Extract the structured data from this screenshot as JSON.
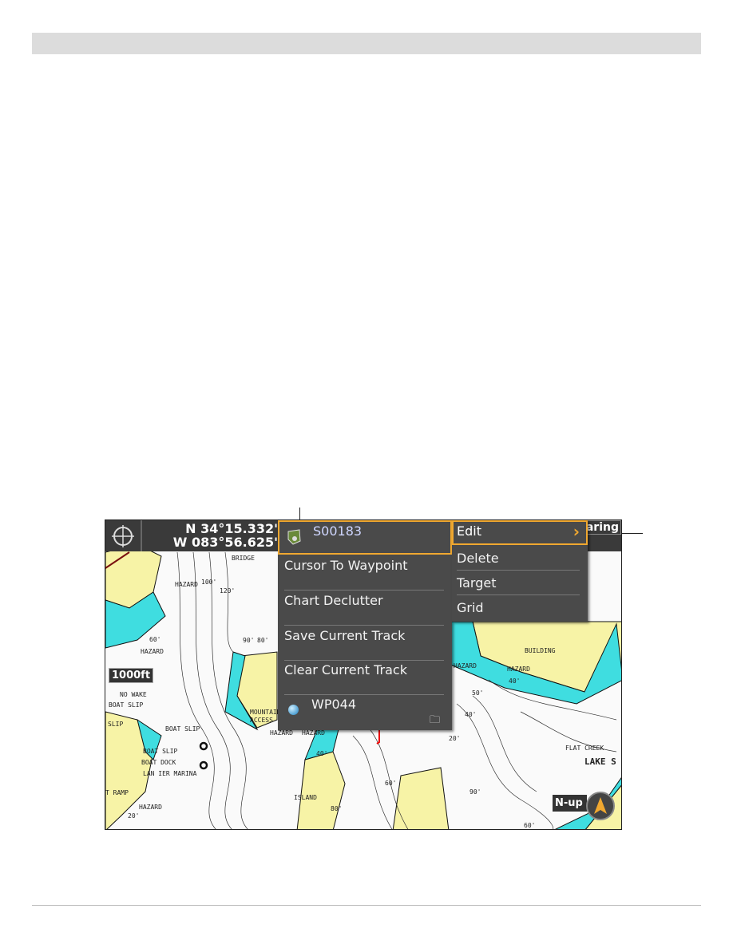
{
  "header": {
    "lat": "N 34°15.332'",
    "lon": "W 083°56.625'",
    "bearing": "earing"
  },
  "menu": {
    "waypoint_name": "S00183",
    "items": [
      "Cursor To Waypoint",
      "Chart Declutter",
      "Save Current Track",
      "Clear Current Track"
    ],
    "bottom_waypoint": "WP044"
  },
  "submenu": {
    "items": [
      "Edit",
      "Delete",
      "Target",
      "Grid"
    ],
    "selected": "Edit"
  },
  "scale": "1000ft",
  "orientation": "N-up",
  "map_labels": [
    "BRIDGE",
    "HAZARD",
    "100'",
    "120'",
    "60'",
    "90'",
    "80'",
    "HAZARD",
    "NO WAKE",
    "BOAT SLIP",
    "SLIP",
    "BOAT SLIP",
    "BOAT SLIP",
    "BOAT DOCK",
    "LAN IER MARINA",
    "T RAMP",
    "HAZARD",
    "20'",
    "MOUNTAIN",
    "ACCESS",
    "HAZARD",
    "HAZARD",
    "ISLAND",
    "40'",
    "BUILDING",
    "HAZARD",
    "HAZARD",
    "40'",
    "50'",
    "40'",
    "20'",
    "FLAT CREEK",
    "LAKE S",
    "60'",
    "90'",
    "60'",
    "80'"
  ],
  "colors": {
    "land": "#f7f3a6",
    "shallow": "#3fdde0",
    "menu_bg": "#4a4a4a",
    "highlight": "#f0a830",
    "header_bg": "#3a3a3a"
  }
}
